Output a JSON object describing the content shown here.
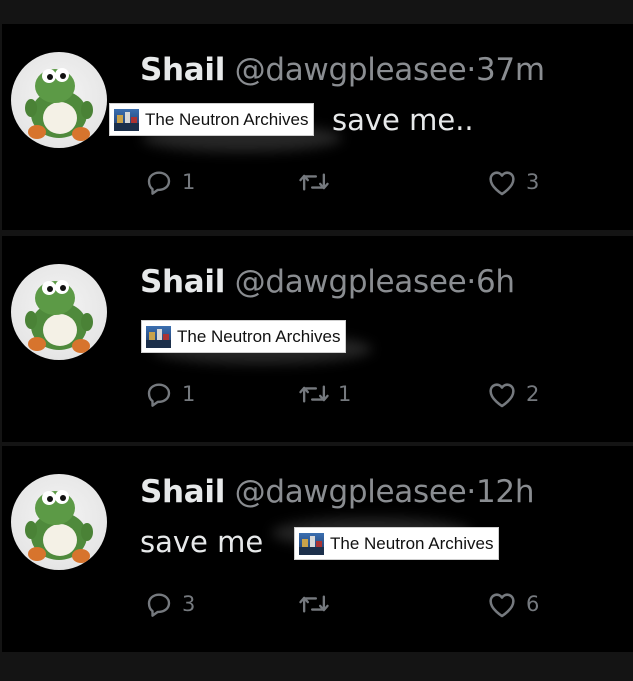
{
  "tweets": [
    {
      "name": "Shail",
      "handle": "@dawgpleasee",
      "sep": "·",
      "time": "37m",
      "text": "save me..",
      "reply_count": "1",
      "retweet_count": "",
      "like_count": "3"
    },
    {
      "name": "Shail",
      "handle": "@dawgpleasee",
      "sep": "·",
      "time": "6h",
      "text": "",
      "reply_count": "1",
      "retweet_count": "1",
      "like_count": "2"
    },
    {
      "name": "Shail",
      "handle": "@dawgpleasee",
      "sep": "·",
      "time": "12h",
      "text": "save me",
      "reply_count": "3",
      "retweet_count": "",
      "like_count": "6"
    }
  ],
  "watermark": {
    "text": "The Neutron Archives"
  },
  "colors": {
    "background": "#000000",
    "frame": "#141414",
    "name": "#e7e9ea",
    "handle": "#8a8d91",
    "action": "#75797e"
  },
  "icons": {
    "reply": "reply-icon",
    "retweet": "retweet-icon",
    "like": "heart-icon"
  }
}
